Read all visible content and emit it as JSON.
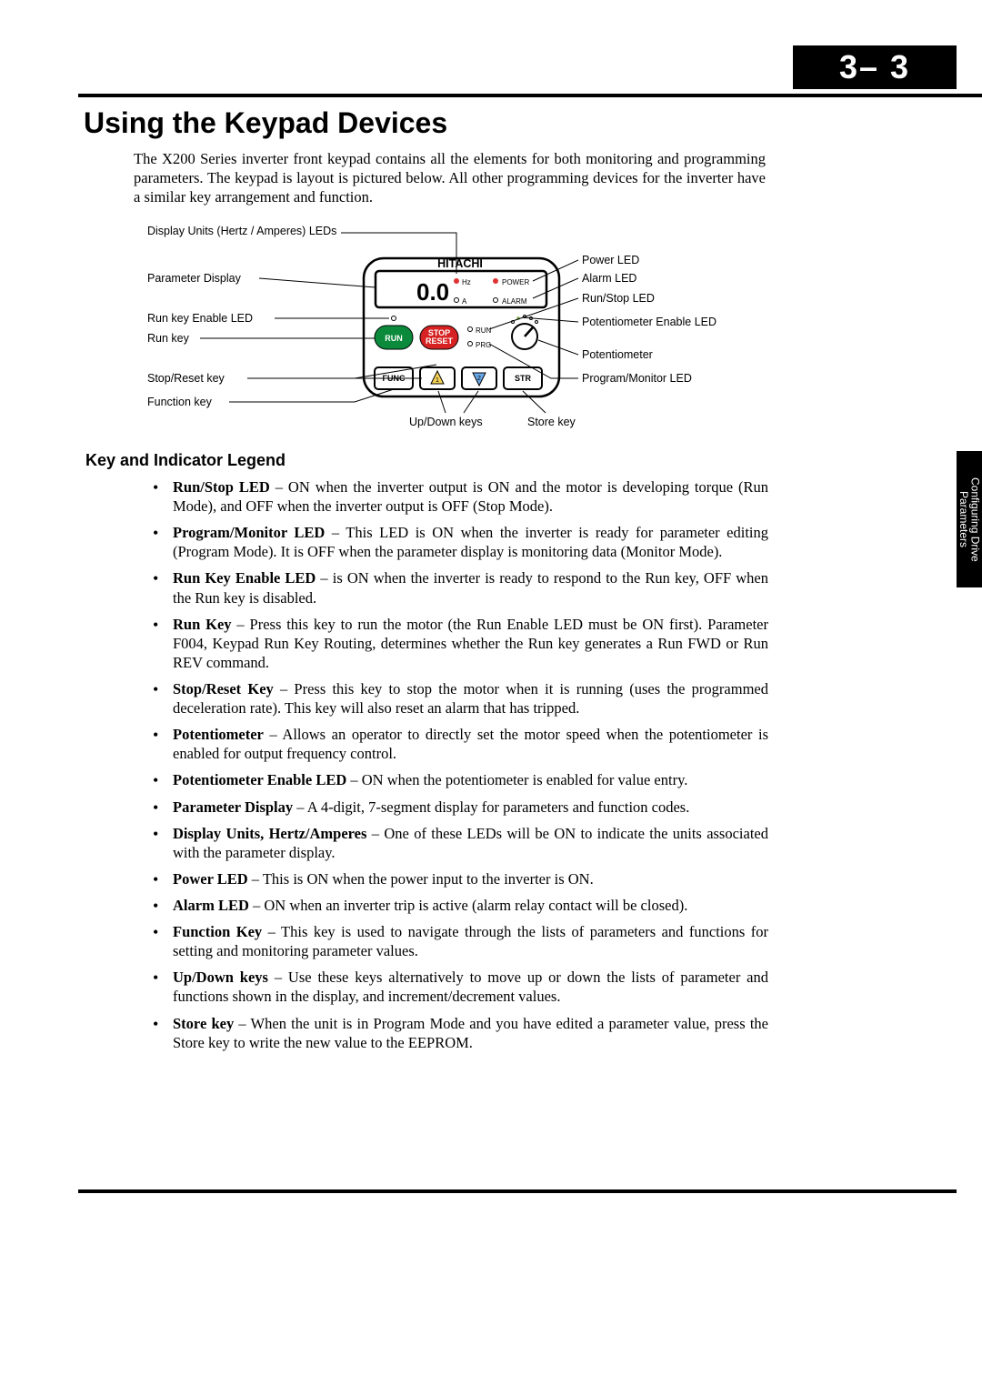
{
  "page_number": "3– 3",
  "side_tab": "Configuring Drive Parameters",
  "title": "Using the Keypad Devices",
  "intro": "The X200 Series inverter front keypad contains all the elements for both monitoring and programming parameters. The keypad is layout is pictured below. All other programming devices for the inverter have a similar key arrangement and function.",
  "section_heading": "Key and Indicator Legend",
  "diagram": {
    "labels": {
      "display_units": "Display Units (Hertz / Amperes) LEDs",
      "parameter_display": "Parameter Display",
      "run_key_enable_led": "Run key Enable LED",
      "run_key": "Run key",
      "stop_reset_key": "Stop/Reset key",
      "function_key": "Function key",
      "up_down_keys": "Up/Down keys",
      "store_key": "Store key",
      "power_led": "Power LED",
      "alarm_led": "Alarm LED",
      "run_stop_led": "Run/Stop LED",
      "pot_enable_led": "Potentiometer Enable LED",
      "potentiometer": "Potentiometer",
      "program_monitor_led": "Program/Monitor LED"
    },
    "keypad": {
      "brand": "HITACHI",
      "display_value": "0.0",
      "hz": "Hz",
      "a": "A",
      "power": "POWER",
      "alarm": "ALARM",
      "run_led": "RUN",
      "prg_led": "PRG",
      "run_btn": "RUN",
      "stop_btn_top": "STOP",
      "stop_btn_bottom": "RESET",
      "func_btn": "FUNC",
      "up_btn": "1",
      "down_btn": "2",
      "str_btn": "STR"
    }
  },
  "legend": [
    {
      "term": "Run/Stop LED",
      "desc": " – ON when the inverter output is ON and the motor is developing torque (Run Mode), and OFF when the inverter output is OFF (Stop Mode)."
    },
    {
      "term": "Program/Monitor LED",
      "desc": " – This LED is ON when the inverter is ready for parameter editing (Program Mode). It is OFF when the parameter display is monitoring data (Monitor Mode)."
    },
    {
      "term": "Run Key Enable LED",
      "desc": " – is ON when the inverter is ready to respond to the Run key, OFF when the Run key is disabled."
    },
    {
      "term": "Run Key",
      "desc": " – Press this key to run the motor (the Run Enable LED must be ON first). Parameter F004, Keypad Run Key Routing, determines whether the Run key generates a Run FWD or Run REV command."
    },
    {
      "term": "Stop/Reset Key",
      "desc": " – Press this key to stop the motor when it is running (uses the programmed deceleration rate). This key will also reset an alarm that has tripped."
    },
    {
      "term": "Potentiometer",
      "desc": " – Allows an operator to directly set the motor speed when the potentiometer is enabled for output frequency control."
    },
    {
      "term": "Potentiometer Enable LED",
      "desc": " – ON when the potentiometer is enabled for value entry."
    },
    {
      "term": "Parameter Display",
      "desc": " – A 4-digit, 7-segment display for parameters and function codes."
    },
    {
      "term": "Display Units, Hertz/Amperes",
      "desc": " – One of these LEDs will be ON to indicate the units associated with the parameter display."
    },
    {
      "term": "Power LED",
      "desc": " – This is ON when the power input to the inverter is ON."
    },
    {
      "term": "Alarm LED",
      "desc": " – ON when an inverter trip is active (alarm relay contact will be closed)."
    },
    {
      "term": "Function Key",
      "desc": " – This key is used to navigate through the lists of parameters and functions for setting and monitoring parameter values."
    },
    {
      "term": "Up/Down keys",
      "desc": " – Use these keys alternatively to move up or down the lists of parameter and functions shown in the display, and increment/decrement values."
    },
    {
      "term": "Store key",
      "desc": " – When the unit is in Program Mode and you have edited a parameter value, press the Store key to write the new value to the EEPROM."
    }
  ]
}
